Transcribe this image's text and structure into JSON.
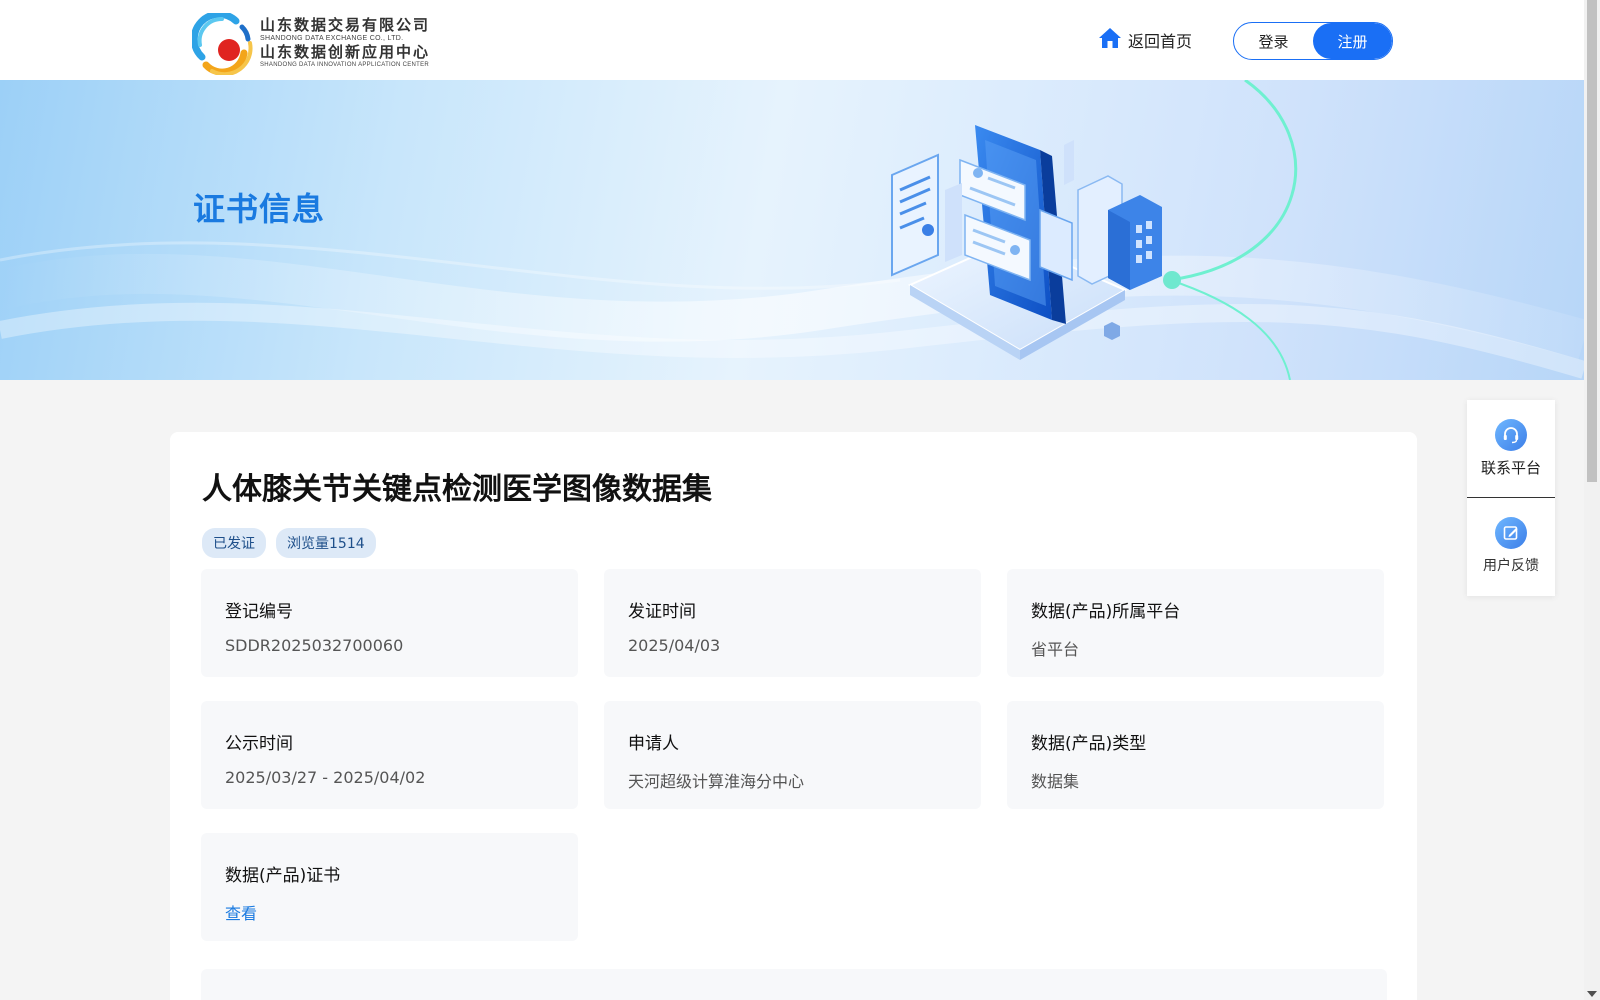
{
  "header": {
    "logo": {
      "cn_line1": "山东数据交易有限公司",
      "en_line1": "SHANDONG DATA EXCHANGE CO., LTD.",
      "cn_line2": "山东数据创新应用中心",
      "en_line2": "SHANDONG DATA INNOVATION APPLICATION CENTER"
    },
    "home_label": "返回首页",
    "login_label": "登录",
    "register_label": "注册"
  },
  "banner": {
    "title": "证书信息"
  },
  "record": {
    "title": "人体膝关节关键点检测医学图像数据集",
    "tags": [
      "已发证",
      "浏览量1514"
    ],
    "fields": [
      {
        "key": "登记编号",
        "value": "SDDR2025032700060"
      },
      {
        "key": "发证时间",
        "value": "2025/04/03"
      },
      {
        "key": "数据(产品)所属平台",
        "value": "省平台"
      },
      {
        "key": "公示时间",
        "value": "2025/03/27 - 2025/04/02"
      },
      {
        "key": "申请人",
        "value": "天河超级计算淮海分中心"
      },
      {
        "key": "数据(产品)类型",
        "value": "数据集"
      },
      {
        "key": "数据(产品)证书",
        "value": "查看"
      }
    ]
  },
  "float_panel": {
    "contact_label": "联系平台",
    "feedback_label": "用户反馈"
  },
  "colors": {
    "primary": "#1a6ff5",
    "banner_title": "#1a7ae0",
    "tag_bg": "#dde9f7"
  },
  "icons": {
    "home": "home-icon",
    "contact": "headset-icon",
    "feedback": "edit-icon"
  }
}
